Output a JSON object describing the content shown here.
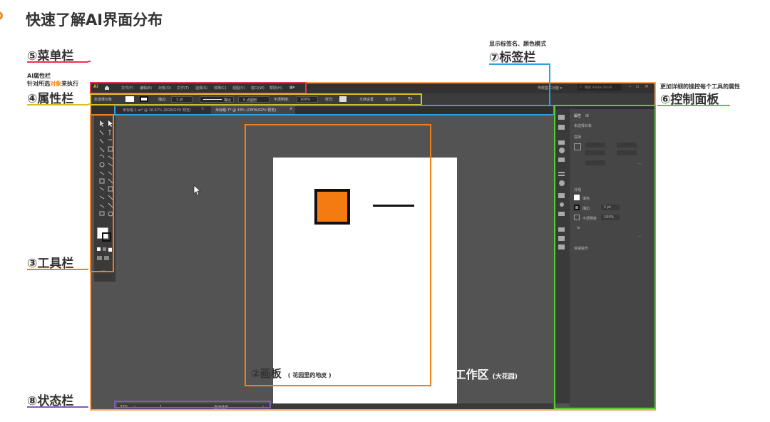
{
  "title": "快速了解AI界面分布",
  "annotations": {
    "menu": "⑤菜单栏",
    "props_note_1": "AI属性栏",
    "props_note_2a": "针对所选",
    "props_note_2b": "对象",
    "props_note_2c": "来执行",
    "props": "④属性栏",
    "tools": "③工具栏",
    "status": "⑧状态栏",
    "tabs_note": "显示标签名、颜色模式",
    "tabs": "⑦标签栏",
    "control_note": "更加详细的操控每个工具的属性",
    "control": "⑥控制面板",
    "artboard": "②画板",
    "artboard_sub": "( 花园里的地皮 )",
    "workspace": "①工作区",
    "workspace_sub": "(大花园)"
  },
  "colors": {
    "menu_box": "#e8344a",
    "props_box": "#d9c021",
    "tools_box": "#ee7d1a",
    "status_box": "#7b5cc4",
    "tabs_box": "#2aa4e0",
    "control_box": "#4fcf2c",
    "workspace_box": "#f3a463",
    "artboard_box": "#ee7d1a",
    "orange_square": "#f47b12",
    "accent": "#f08a1d"
  },
  "app": {
    "logo": "Ai",
    "home_icon": "home-icon",
    "menu_items": [
      "文件(F)",
      "编辑(E)",
      "对象(O)",
      "文字(T)",
      "选择(S)",
      "效果(C)",
      "视图(V)",
      "窗口(W)",
      "帮助(H)",
      "▦▾"
    ],
    "search_placeholder": "搜索 Adobe Stock",
    "workspace_label": "传统基本功能 ▾",
    "prop_items": [
      "未选择对象",
      "描边:",
      "1 pt",
      "等比",
      "5 点圆形",
      "不透明度:",
      "100%",
      "样式:",
      "文档设置",
      "首选项"
    ],
    "tabs": [
      "未标题-1.ai* @ 16.67% (RGB/GPU 预览)",
      "未标题-7* @ 33% (CMYK/GPU 预览)"
    ],
    "status_zoom": "33%",
    "status_page": "1",
    "status_tool": "直接选择",
    "panel_tabs": [
      "属性",
      "库"
    ],
    "panel_no_selection": "未选择对象",
    "panel_section_transform": "变换",
    "panel_section_appearance": "外观",
    "panel_fill_label": "填色",
    "panel_stroke_label": "描边",
    "panel_stroke_value": "1 pt",
    "panel_opacity_label": "不透明度",
    "panel_opacity_value": "100%",
    "panel_quick_actions": "快速操作"
  }
}
